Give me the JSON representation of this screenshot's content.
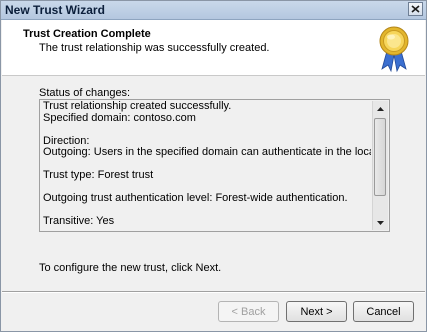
{
  "window": {
    "title": "New Trust Wizard"
  },
  "header": {
    "title": "Trust Creation Complete",
    "subtitle": "The trust relationship was successfully created.",
    "badge_icon": "award-ribbon-icon"
  },
  "status": {
    "label": "Status of changes:",
    "lines": [
      "Trust relationship created successfully.",
      "Specified domain: contoso.com",
      "",
      "Direction:",
      "Outgoing: Users in the specified domain can authenticate in the local domain.",
      "",
      "Trust type: Forest trust",
      "",
      "Outgoing trust authentication level: Forest-wide authentication.",
      "",
      "Transitive: Yes"
    ]
  },
  "hint": "To configure the new trust, click Next.",
  "buttons": {
    "back": "< Back",
    "next": "Next >",
    "cancel": "Cancel"
  },
  "colors": {
    "titlebar": "#b4c7df",
    "badge_gold": "#e3b62c",
    "badge_ribbon": "#3b6fd0"
  }
}
